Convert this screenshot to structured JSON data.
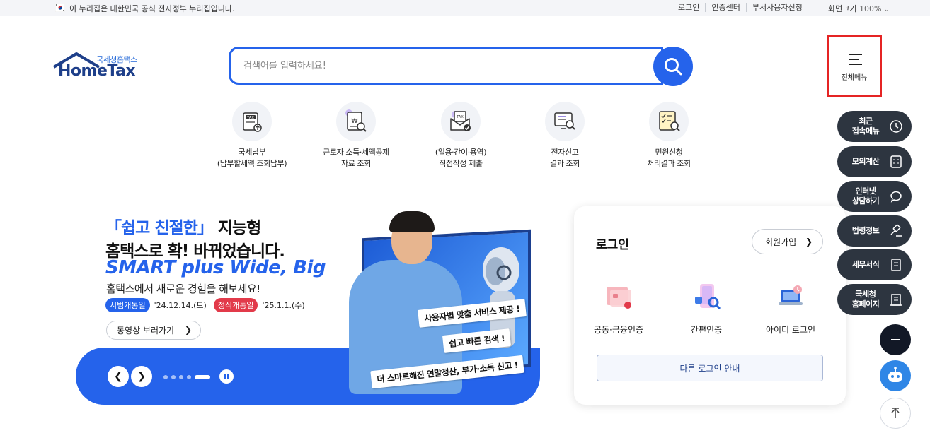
{
  "gov_bar": {
    "notice": "이 누리집은 대한민국 공식 전자정부 누리집입니다.",
    "links": [
      "로그인",
      "인증센터",
      "부서사용자신청"
    ],
    "zoom_label": "화면크기",
    "zoom_value": "100%"
  },
  "header": {
    "logo_sub": "국세청홈택스",
    "logo_name": "HomeTax",
    "search_placeholder": "검색어를 입력하세요!",
    "all_menu_label": "전체메뉴"
  },
  "quick_services": [
    {
      "icon": "tax-payment-icon",
      "line1": "국세납부",
      "line2": "(납부할세액 조회납부)"
    },
    {
      "icon": "deduction-document-icon",
      "line1": "근로자 소득·세액공제",
      "line2": "자료 조회"
    },
    {
      "icon": "tax-envelope-icon",
      "line1": "(일용·간이·용역)",
      "line2": "직접작성 제출"
    },
    {
      "icon": "report-search-icon",
      "line1": "전자신고",
      "line2": "결과 조회"
    },
    {
      "icon": "civil-checklist-icon",
      "line1": "민원신청",
      "line2": "처리결과 조회"
    }
  ],
  "banner": {
    "title_highlight": "「쉽고 친절한」",
    "title_rest": " 지능형",
    "title_line2": "홈택스로 확! 바뀌었습니다.",
    "title_line3": "SMART plus Wide, Big",
    "subtitle": "홈택스에서 새로운 경험을 해보세요!",
    "pilot_label": "시범개통일",
    "pilot_date": "'24.12.14.(토)",
    "official_label": "정식개통일",
    "official_date": "'25.1.1.(수)",
    "video_button": "동영상 보러가기",
    "bubble1": "사용자별 맞춤 서비스 제공 !",
    "bubble2": "쉽고 빠른 검색 !",
    "bubble3": "더 스마트해진 연말정산, 부가·소득 신고 !",
    "slide_count": 5,
    "active_slide": 5
  },
  "login": {
    "title": "로그인",
    "join_button": "회원가입",
    "options": [
      "공동·금융인증",
      "간편인증",
      "아이디 로그인"
    ],
    "other_login": "다른 로그인 안내"
  },
  "quick_menu": [
    {
      "line1": "최근",
      "line2": "접속메뉴",
      "icon": "clock-icon"
    },
    {
      "line1": "모의계산",
      "line2": "",
      "icon": "calculator-icon"
    },
    {
      "line1": "인터넷",
      "line2": "상담하기",
      "icon": "chat-icon"
    },
    {
      "line1": "법령정보",
      "line2": "",
      "icon": "gavel-icon"
    },
    {
      "line1": "세무서식",
      "line2": "",
      "icon": "form-icon"
    },
    {
      "line1": "국세청",
      "line2": "홈페이지",
      "icon": "building-icon"
    }
  ],
  "colors": {
    "primary": "#2563eb",
    "dark_navy": "#1e3f8a",
    "quick_menu_bg": "#2d3540",
    "highlight_red": "#e52424"
  }
}
